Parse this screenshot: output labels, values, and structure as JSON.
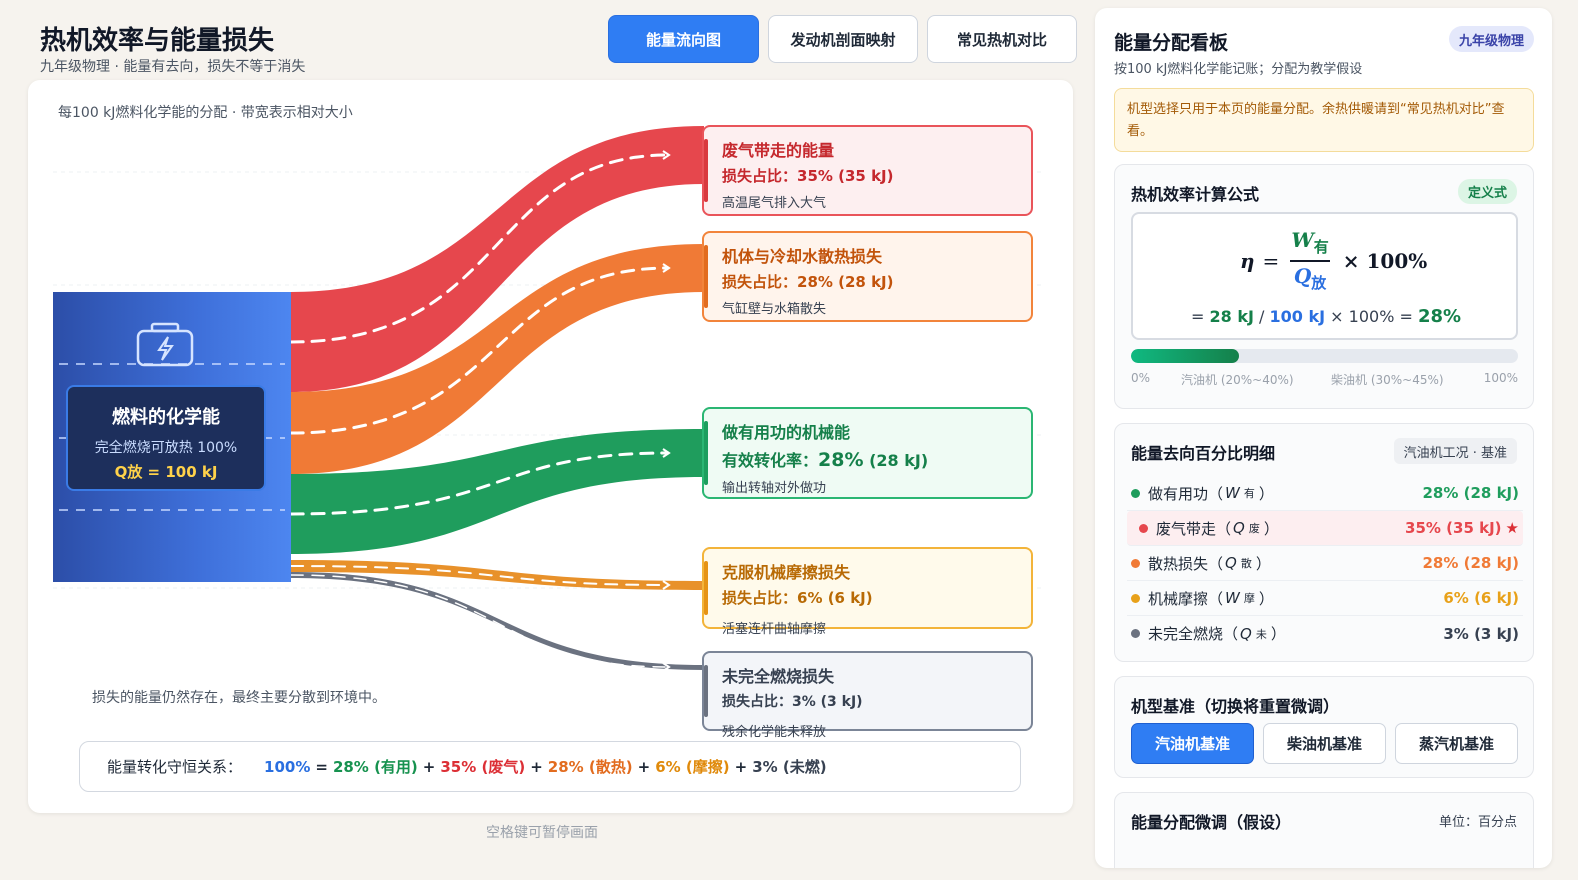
{
  "header": {
    "title": "热机效率与能量损失",
    "subtitle": "九年级物理 · 能量有去向，损失不等于消失"
  },
  "tabs": [
    {
      "label": "能量流向图",
      "active": true
    },
    {
      "label": "发动机剖面映射",
      "active": false
    },
    {
      "label": "常见热机对比",
      "active": false
    }
  ],
  "flow": {
    "caption": "每100 kJ燃料化学能的分配 · 带宽表示相对大小",
    "source": {
      "title": "燃料的化学能",
      "line2": "完全燃烧可放热 100%",
      "line3": "Q放 = 100 kJ",
      "icon": "battery-bolt-icon"
    },
    "outputs": [
      {
        "key": "exhaust",
        "title": "废气带走的能量",
        "ratio": "损失占比：35% (35 kJ)",
        "desc": "高温尾气排入大气",
        "color": "#e6474d",
        "share": 35
      },
      {
        "key": "cool",
        "title": "机体与冷却水散热损失",
        "ratio": "损失占比：28% (28 kJ)",
        "desc": "气缸壁与水箱散失",
        "color": "#f07a36",
        "share": 28
      },
      {
        "key": "useful",
        "title": "做有用功的机械能",
        "ratio_prefix": "有效转化率：",
        "ratio_big": "28%",
        "ratio_suffix": " (28 kJ)",
        "desc": "输出转轴对外做功",
        "color": "#1f9d5d",
        "share": 28
      },
      {
        "key": "friction",
        "title": "克服机械摩擦损失",
        "ratio": "损失占比：6% (6 kJ)",
        "desc": "活塞连杆曲轴摩擦",
        "color": "#e8912a",
        "share": 6
      },
      {
        "key": "unburnt",
        "title": "未完全燃烧损失",
        "ratio": "损失占比：3% (3 kJ)",
        "desc": "残余化学能未释放",
        "color": "#6b7280",
        "share": 3
      }
    ],
    "loss_note": "损失的能量仍然存在，最终主要分散到环境中。",
    "conservation": {
      "label": "能量转化守恒关系：",
      "total": "100%",
      "eq": "=",
      "plus": "+",
      "useful": "28% (有用)",
      "exhaust": "35% (废气)",
      "cool": "28% (散热)",
      "friction": "6% (摩擦)",
      "unburnt": "3% (未燃)"
    }
  },
  "pause_hint": "空格键可暂停画面",
  "dashboard": {
    "title": "能量分配看板",
    "badge": "九年级物理",
    "subtitle": "按100 kJ燃料化学能记账；分配为教学假设",
    "notice": "机型选择只用于本页的能量分配。余热供暖请到“常见热机对比”查看。",
    "formula": {
      "title": "热机效率计算公式",
      "tag": "定义式",
      "eta": "η",
      "equals": "=",
      "numerator": "W",
      "numerator_sub": "有",
      "denominator": "Q",
      "denominator_sub": "放",
      "times": "× 100%",
      "calc_eq": "=",
      "calc_w": "28 kJ",
      "calc_div": "/",
      "calc_q": "100 kJ",
      "calc_times": "× 100% =",
      "calc_result": "28%",
      "efficiency": 0.28,
      "scale": [
        "0%",
        "汽油机 (20%~40%)",
        "柴油机 (30%~45%)",
        "100%"
      ]
    },
    "detail": {
      "title": "能量去向百分比明细",
      "tag": "汽油机工况 · 基准",
      "rows": [
        {
          "label": "做有用功（",
          "sym": "W",
          "sub": "有",
          "close": "）",
          "value": "28% (28 kJ)",
          "color": "#1f9d5d",
          "highlight": false
        },
        {
          "label": "废气带走（",
          "sym": "Q",
          "sub": "废",
          "close": "）",
          "value": "35% (35 kJ)",
          "color": "#e6474d",
          "highlight": true,
          "star": "★"
        },
        {
          "label": "散热损失（",
          "sym": "Q",
          "sub": "散",
          "close": "）",
          "value": "28% (28 kJ)",
          "color": "#f07a36",
          "highlight": false
        },
        {
          "label": "机械摩擦（",
          "sym": "W",
          "sub": "摩",
          "close": "）",
          "value": "6% (6 kJ)",
          "color": "#e8a11a",
          "highlight": false
        },
        {
          "label": "未完全燃烧（",
          "sym": "Q",
          "sub": "未",
          "close": "）",
          "value": "3% (3 kJ)",
          "color": "#6b7280",
          "highlight": false
        }
      ]
    },
    "engine": {
      "title": "机型基准（切换将重置微调）",
      "options": [
        {
          "label": "汽油机基准",
          "active": true
        },
        {
          "label": "柴油机基准",
          "active": false
        },
        {
          "label": "蒸汽机基准",
          "active": false
        }
      ]
    },
    "tune": {
      "title": "能量分配微调（假设）",
      "unit": "单位：百分点"
    }
  }
}
